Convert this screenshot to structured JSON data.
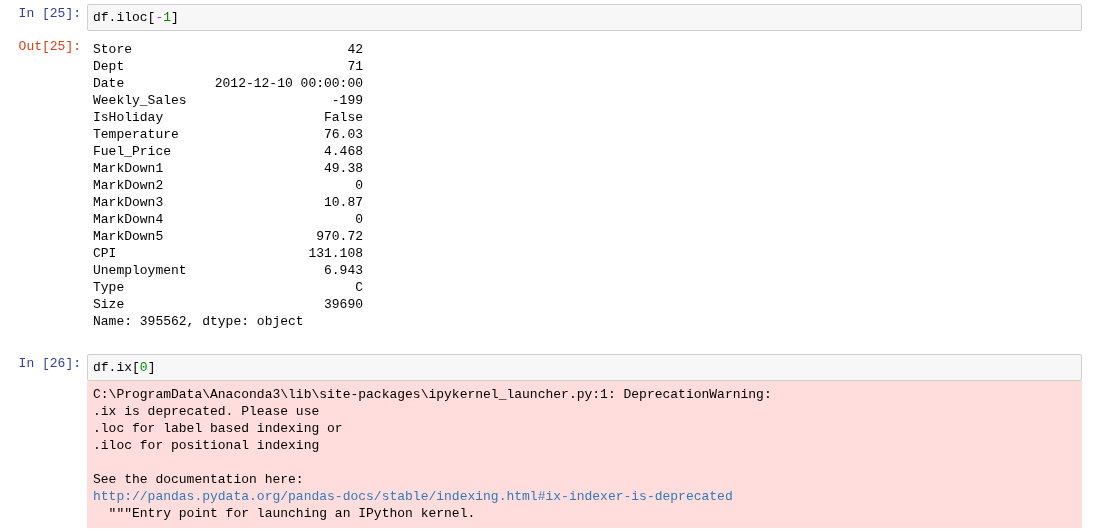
{
  "cells": [
    {
      "prompt": "In [25]:",
      "code": [
        {
          "kind": "plain",
          "text": "df.iloc["
        },
        {
          "kind": "operator",
          "text": "-"
        },
        {
          "kind": "number",
          "text": "1"
        },
        {
          "kind": "plain",
          "text": "]"
        }
      ],
      "output": {
        "kind": "series",
        "prompt": "Out[25]:",
        "rows": [
          {
            "label": "Store",
            "value": "42"
          },
          {
            "label": "Dept",
            "value": "71"
          },
          {
            "label": "Date",
            "value": "2012-12-10 00:00:00"
          },
          {
            "label": "Weekly_Sales",
            "value": "-199"
          },
          {
            "label": "IsHoliday",
            "value": "False"
          },
          {
            "label": "Temperature",
            "value": "76.03"
          },
          {
            "label": "Fuel_Price",
            "value": "4.468"
          },
          {
            "label": "MarkDown1",
            "value": "49.38"
          },
          {
            "label": "MarkDown2",
            "value": "0"
          },
          {
            "label": "MarkDown3",
            "value": "10.87"
          },
          {
            "label": "MarkDown4",
            "value": "0"
          },
          {
            "label": "MarkDown5",
            "value": "970.72"
          },
          {
            "label": "CPI",
            "value": "131.108"
          },
          {
            "label": "Unemployment",
            "value": "6.943"
          },
          {
            "label": "Type",
            "value": "C"
          },
          {
            "label": "Size",
            "value": "39690"
          }
        ],
        "footer": "Name: 395562, dtype: object"
      }
    },
    {
      "prompt": "In [26]:",
      "code": [
        {
          "kind": "plain",
          "text": "df.ix["
        },
        {
          "kind": "number",
          "text": "0"
        },
        {
          "kind": "plain",
          "text": "]"
        }
      ],
      "output": {
        "kind": "stderr",
        "paragraphs": [
          [
            {
              "kind": "text",
              "text": "C:\\ProgramData\\Anaconda3\\lib\\site-packages\\ipykernel_launcher.py:1: DeprecationWarning:"
            },
            {
              "kind": "text",
              "text": ".ix is deprecated. Please use"
            },
            {
              "kind": "text",
              "text": ".loc for label based indexing or"
            },
            {
              "kind": "text",
              "text": ".iloc for positional indexing"
            }
          ],
          [
            {
              "kind": "text",
              "text": "See the documentation here:"
            },
            {
              "kind": "link",
              "text": "http://pandas.pydata.org/pandas-docs/stable/indexing.html#ix-indexer-is-deprecated"
            },
            {
              "kind": "text",
              "text": "  \"\"\"Entry point for launching an IPython kernel."
            }
          ]
        ]
      }
    }
  ]
}
